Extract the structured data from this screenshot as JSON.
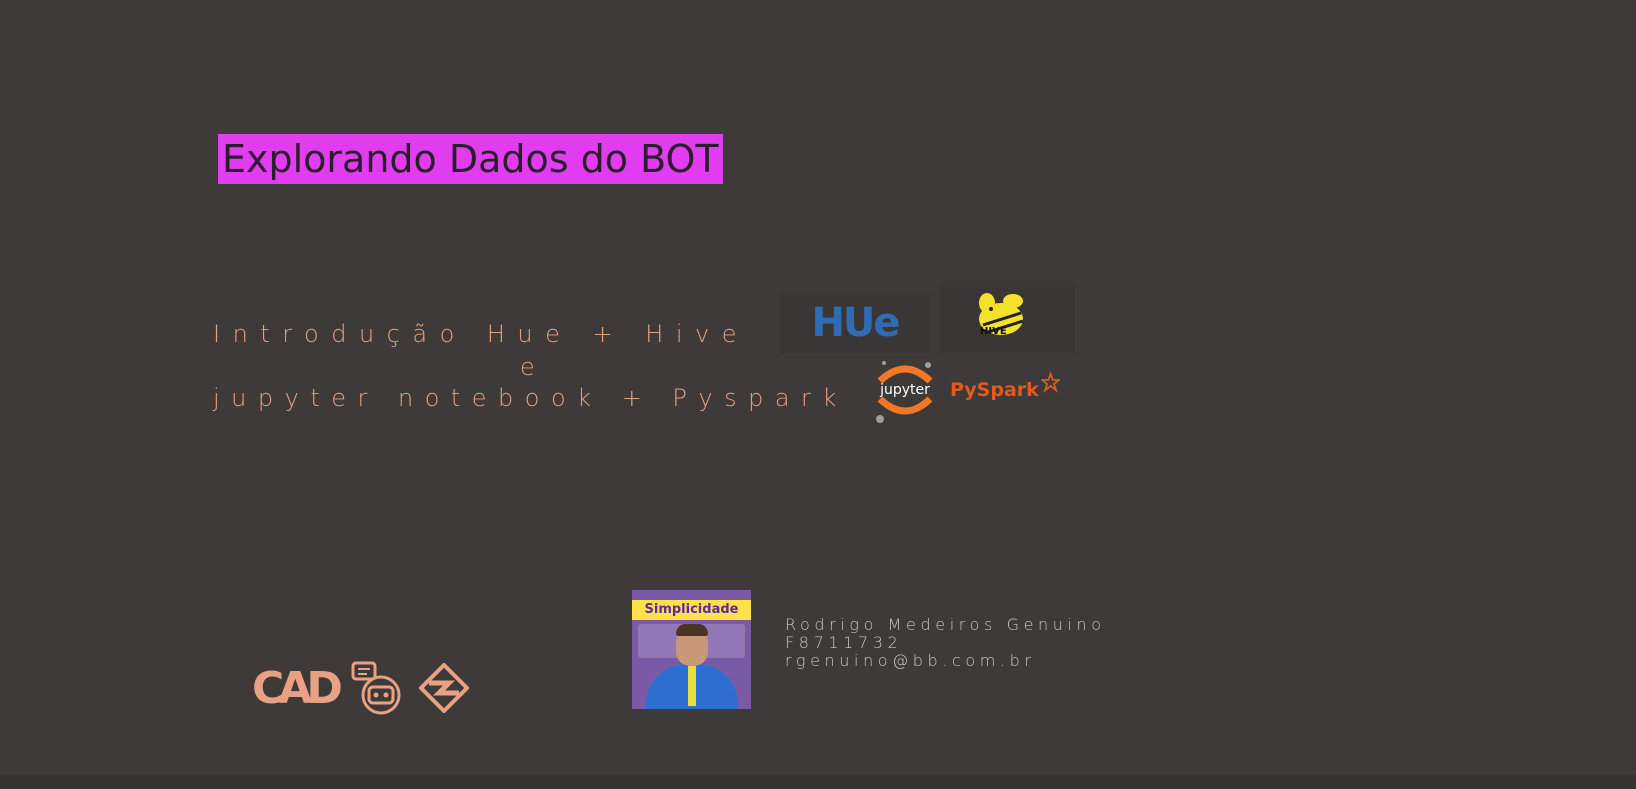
{
  "slide": {
    "title": "Explorando Dados do BOT",
    "subtitle": {
      "line1": "Introdução Hue + Hive",
      "line2": "e",
      "line3": "jupyter notebook + Pyspark"
    },
    "logos": {
      "hue": "HUe",
      "hive": "HIVE",
      "jupyter": "jupyter",
      "pyspark": "PySpark",
      "cad": "CAD"
    },
    "photo_banner": "Simplicidade",
    "presenter": {
      "name": "Rodrigo Medeiros Genuino",
      "id": "F8711732",
      "email": "rgenuino@bb.com.br"
    }
  },
  "colors": {
    "background": "#3e3a3a",
    "title_highlight": "#e23cf0",
    "subtitle": "#e5a083",
    "accent_logo": "#e8a283"
  }
}
